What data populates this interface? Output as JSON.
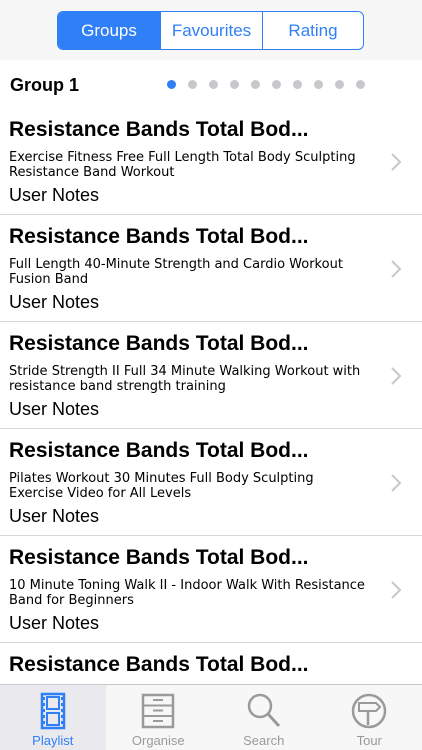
{
  "segments": [
    {
      "label": "Groups",
      "active": true
    },
    {
      "label": "Favourites",
      "active": false
    },
    {
      "label": "Rating",
      "active": false
    }
  ],
  "group": {
    "title": "Group 1",
    "page_count": 10,
    "current_page": 1
  },
  "items": [
    {
      "title": "Resistance Bands Total Bod...",
      "desc": "Exercise Fitness Free Full Length Total Body Sculpting Resistance Band Workout",
      "notes": "User Notes"
    },
    {
      "title": "Resistance Bands Total Bod...",
      "desc": "Full Length 40-Minute Strength and Cardio Workout Fusion Band",
      "notes": "User Notes"
    },
    {
      "title": "Resistance Bands Total Bod...",
      "desc": "Stride  Strength II  Full 34 Minute Walking Workout with resistance band strength training",
      "notes": "User Notes"
    },
    {
      "title": "Resistance Bands Total Bod...",
      "desc": "Pilates Workout 30 Minutes Full Body Sculpting Exercise Video for All Levels",
      "notes": "User Notes"
    },
    {
      "title": "Resistance Bands Total Bod...",
      "desc": "10 Minute Toning Walk II - Indoor Walk With Resistance Band for Beginners",
      "notes": "User Notes"
    },
    {
      "title": "Resistance Bands Total Bod..."
    }
  ],
  "tabs": [
    {
      "label": "Playlist",
      "icon": "film-icon",
      "active": true
    },
    {
      "label": "Organise",
      "icon": "cabinet-icon",
      "active": false
    },
    {
      "label": "Search",
      "icon": "magnifier-icon",
      "active": false
    },
    {
      "label": "Tour",
      "icon": "signpost-icon",
      "active": false
    }
  ],
  "colors": {
    "accent": "#2f7ff7",
    "inactive": "#9a9a9a"
  }
}
